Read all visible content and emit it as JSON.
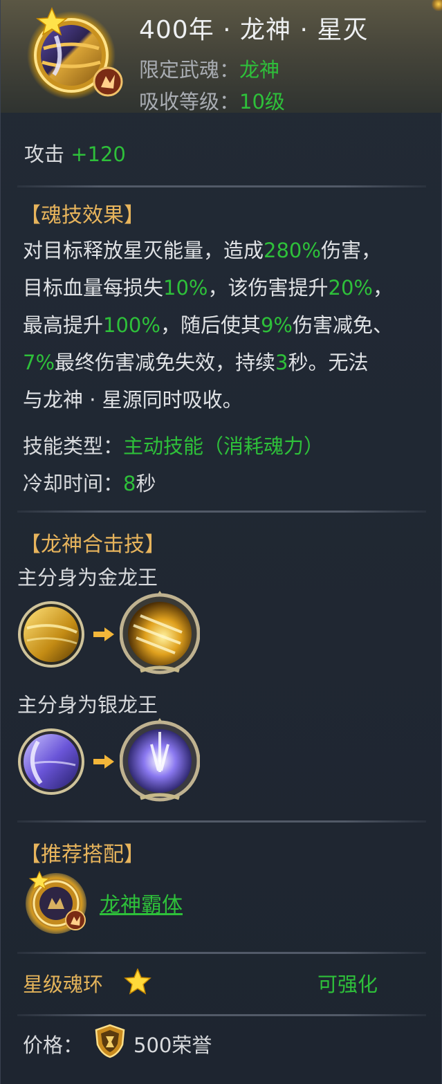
{
  "header": {
    "title": "400年 · 龙神 · 星灭",
    "limit_label": "限定武魂：",
    "limit_value": "龙神",
    "absorb_label": "吸收等级：",
    "absorb_value": "10级"
  },
  "stats": {
    "attack_label": "攻击",
    "attack_value": "+120"
  },
  "effect": {
    "heading": "【魂技效果】",
    "lines": [
      [
        [
          "t",
          "对目标释放星灭能量，造成"
        ],
        [
          "g",
          "280%"
        ],
        [
          "t",
          "伤害，"
        ]
      ],
      [
        [
          "t",
          "目标血量每损失"
        ],
        [
          "g",
          "10%"
        ],
        [
          "t",
          "，该伤害提升"
        ],
        [
          "g",
          "20%"
        ],
        [
          "t",
          "，"
        ]
      ],
      [
        [
          "t",
          "最高提升"
        ],
        [
          "g",
          "100%"
        ],
        [
          "t",
          "，随后使其"
        ],
        [
          "g",
          "9%"
        ],
        [
          "t",
          "伤害减免、"
        ]
      ],
      [
        [
          "g",
          "7%"
        ],
        [
          "t",
          "最终伤害减免失效，持续"
        ],
        [
          "g",
          "3"
        ],
        [
          "t",
          "秒。无法"
        ]
      ],
      [
        [
          "t",
          "与龙神 · 星源同时吸收。"
        ]
      ]
    ],
    "type_label": "技能类型：",
    "type_value": "主动技能（消耗魂力）",
    "cooldown_label": "冷却时间：",
    "cooldown_value": "8",
    "cooldown_unit": "秒"
  },
  "combo": {
    "heading": "【龙神合击技】",
    "gold_caption": "主分身为金龙王",
    "silver_caption": "主分身为银龙王"
  },
  "recommend": {
    "heading": "【推荐搭配】",
    "link_text": "龙神霸体"
  },
  "star": {
    "label": "星级魂环",
    "status": "可强化"
  },
  "price": {
    "label": "价格：",
    "value": "500荣誉"
  },
  "colors": {
    "green": "#2ec03a",
    "gold_heading": "#e7b45c",
    "panel_bg": "#1f2631"
  }
}
